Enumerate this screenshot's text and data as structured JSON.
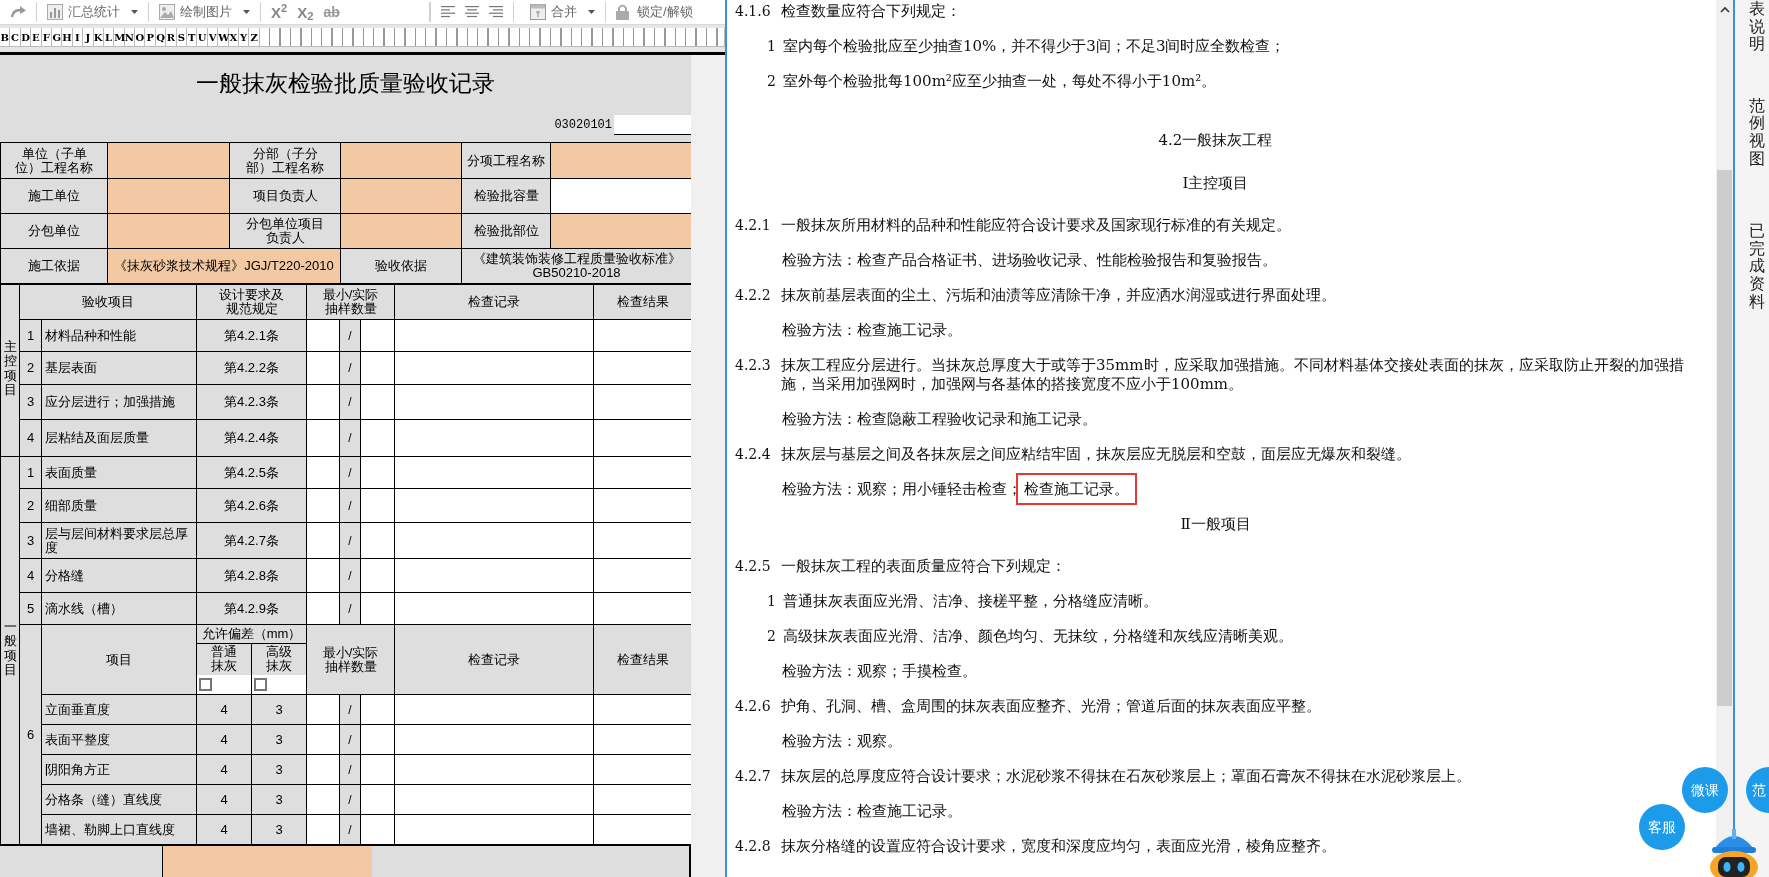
{
  "toolbar": {
    "groups": [
      [
        {
          "kind": "redo"
        }
      ],
      [
        {
          "kind": "chart_menu",
          "label": "汇总统计"
        }
      ],
      [
        {
          "kind": "picture_menu",
          "label": "绘制图片"
        }
      ],
      [
        {
          "kind": "superscript",
          "label": "X$^{2}$"
        },
        {
          "kind": "subscript",
          "label": "X$_{2}$"
        },
        {
          "kind": "strikethrough",
          "label": "ab"
        }
      ],
      [
        {
          "kind": "align_left"
        },
        {
          "kind": "align_center"
        },
        {
          "kind": "align_right"
        }
      ],
      [
        {
          "kind": "merge_menu",
          "label": "合并"
        }
      ],
      [
        {
          "kind": "lock",
          "label": "锁定/解锁"
        }
      ]
    ]
  },
  "column_letters": [
    "B",
    "C",
    "D",
    "E",
    "F",
    "G",
    "H",
    "I",
    "J",
    "K",
    "L",
    "M",
    "N",
    "O",
    "P",
    "Q",
    "R",
    "S",
    "T",
    "U",
    "V",
    "W",
    "X",
    "Y",
    "Z"
  ],
  "form": {
    "title": "一般抹灰检验批质量验收记录",
    "code": "03020101",
    "header_rows": [
      [
        {
          "kind": "label",
          "text": "单位（子单位）工程名称"
        },
        {
          "kind": "required"
        },
        {
          "kind": "label",
          "text": "分部（子分部）工程名称"
        },
        {
          "kind": "required"
        },
        {
          "kind": "label",
          "text": "分项工程名称"
        },
        {
          "kind": "required"
        }
      ],
      [
        {
          "kind": "label",
          "text": "施工单位"
        },
        {
          "kind": "required"
        },
        {
          "kind": "label",
          "text": "项目负责人"
        },
        {
          "kind": "required"
        },
        {
          "kind": "label",
          "text": "检验批容量"
        },
        {
          "kind": "blank"
        }
      ],
      [
        {
          "kind": "label",
          "text": "分包单位"
        },
        {
          "kind": "required"
        },
        {
          "kind": "label",
          "text": "分包单位项目负责人"
        },
        {
          "kind": "required"
        },
        {
          "kind": "label",
          "text": "检验批部位"
        },
        {
          "kind": "required"
        }
      ],
      [
        {
          "kind": "label",
          "text": "施工依据"
        },
        {
          "kind": "required",
          "text": "《抹灰砂浆技术规程》JGJ/T220-2010"
        },
        {
          "kind": "label",
          "text": "验收依据"
        },
        {
          "kind": "label",
          "text": "《建筑装饰装修工程质量验收标准》\nGB50210-2018"
        }
      ]
    ],
    "columns": [
      "验收项目",
      "设计要求及规范规定",
      "最小/实际抽样数量",
      "检查记录",
      "检查结果"
    ],
    "main_control": {
      "label": "主控项目",
      "rows": [
        {
          "no": "1",
          "item": "材料品种和性能",
          "clause": "第4.2.1条",
          "sample": "/"
        },
        {
          "no": "2",
          "item": "基层表面",
          "clause": "第4.2.2条",
          "sample": "/"
        },
        {
          "no": "3",
          "item": "应分层进行；加强措施",
          "clause": "第4.2.3条",
          "sample": "/"
        },
        {
          "no": "4",
          "item": "层粘结及面层质量",
          "clause": "第4.2.4条",
          "sample": "/"
        }
      ]
    },
    "general": {
      "label": "一般项目",
      "rows": [
        {
          "no": "1",
          "item": "表面质量",
          "clause": "第4.2.5条",
          "sample": "/"
        },
        {
          "no": "2",
          "item": "细部质量",
          "clause": "第4.2.6条",
          "sample": "/"
        },
        {
          "no": "3",
          "item": "层与层间材料要求层总厚度",
          "clause": "第4.2.7条",
          "sample": "/"
        },
        {
          "no": "4",
          "item": "分格缝",
          "clause": "第4.2.8条",
          "sample": "/"
        },
        {
          "no": "5",
          "item": "滴水线（槽）",
          "clause": "第4.2.9条",
          "sample": "/"
        }
      ],
      "tolerance": {
        "no": "6",
        "item_header": "项目",
        "group_header": "允许偏差（mm）",
        "grades": [
          {
            "label": "普通抹灰",
            "checked": false
          },
          {
            "label": "高级抹灰",
            "checked": false
          }
        ],
        "sample_header": "最小/实际抽样数量",
        "record_header": "检查记录",
        "result_header": "检查结果",
        "rows": [
          {
            "item": "立面垂直度",
            "ordinary": "4",
            "advanced": "3",
            "sample": "/"
          },
          {
            "item": "表面平整度",
            "ordinary": "4",
            "advanced": "3",
            "sample": "/"
          },
          {
            "item": "阴阳角方正",
            "ordinary": "4",
            "advanced": "3",
            "sample": "/"
          },
          {
            "item": "分格条（缝）直线度",
            "ordinary": "4",
            "advanced": "3",
            "sample": "/"
          },
          {
            "item": "墙裙、勒脚上口直线度",
            "ordinary": "4",
            "advanced": "3",
            "sample": "/"
          }
        ]
      }
    }
  },
  "document": {
    "paragraphs": [
      {
        "kind": "clause",
        "number": "4.1.6",
        "text": "检查数量应符合下列规定："
      },
      {
        "kind": "item",
        "number": "1",
        "text": "室内每个检验批应至少抽查10%，并不得少于3间；不足3间时应全数检查；"
      },
      {
        "kind": "item",
        "number": "2",
        "text": "室外每个检验批每100m²应至少抽查一处，每处不得小于10m²。"
      },
      {
        "kind": "title",
        "text": "4.2一般抹灰工程"
      },
      {
        "kind": "subtitle",
        "text": "Ⅰ主控项目"
      },
      {
        "kind": "clause",
        "number": "4.2.1",
        "text": "一般抹灰所用材料的品种和性能应符合设计要求及国家现行标准的有关规定。"
      },
      {
        "kind": "method",
        "text": "检验方法：检查产品合格证书、进场验收记录、性能检验报告和复验报告。"
      },
      {
        "kind": "clause",
        "number": "4.2.2",
        "text": "抹灰前基层表面的尘土、污垢和油渍等应清除干净，并应洒水润湿或进行界面处理。"
      },
      {
        "kind": "method",
        "text": "检验方法：检查施工记录。"
      },
      {
        "kind": "clause",
        "number": "4.2.3",
        "text": "抹灰工程应分层进行。当抹灰总厚度大于或等于35mm时，应采取加强措施。不同材料基体交接处表面的抹灰，应采取防止开裂的加强措施，当采用加强网时，加强网与各基体的搭接宽度不应小于100mm。"
      },
      {
        "kind": "method",
        "text": "检验方法：检查隐蔽工程验收记录和施工记录。"
      },
      {
        "kind": "clause",
        "number": "4.2.4",
        "text": "抹灰层与基层之间及各抹灰层之间应粘结牢固，抹灰层应无脱层和空鼓，面层应无爆灰和裂缝。"
      },
      {
        "kind": "method",
        "text": "检验方法：观察；用小锤轻击检查；",
        "highlight": "检查施工记录。"
      },
      {
        "kind": "subtitle",
        "text": "Ⅱ一般项目"
      },
      {
        "kind": "clause",
        "number": "4.2.5",
        "text": "一般抹灰工程的表面质量应符合下列规定："
      },
      {
        "kind": "item",
        "number": "1",
        "text": "普通抹灰表面应光滑、洁净、接槎平整，分格缝应清晰。"
      },
      {
        "kind": "item",
        "number": "2",
        "text": "高级抹灰表面应光滑、洁净、颜色均匀、无抹纹，分格缝和灰线应清晰美观。"
      },
      {
        "kind": "method",
        "text": "检验方法：观察；手摸检查。"
      },
      {
        "kind": "clause",
        "number": "4.2.6",
        "text": "护角、孔洞、槽、盒周围的抹灰表面应整齐、光滑；管道后面的抹灰表面应平整。"
      },
      {
        "kind": "method",
        "text": "检验方法：观察。"
      },
      {
        "kind": "clause",
        "number": "4.2.7",
        "text": "抹灰层的总厚度应符合设计要求；水泥砂浆不得抹在石灰砂浆层上；罩面石膏灰不得抹在水泥砂浆层上。"
      },
      {
        "kind": "method",
        "text": "检验方法：检查施工记录。"
      },
      {
        "kind": "clause",
        "number": "4.2.8",
        "text": "抹灰分格缝的设置应符合设计要求，宽度和深度应均匀，表面应光滑，棱角应整齐。"
      }
    ]
  },
  "side_panel": {
    "tabs": [
      "表说明",
      "范例视图",
      "已完成资料"
    ]
  },
  "floating_buttons": [
    {
      "label": "微课"
    },
    {
      "label": "范"
    },
    {
      "label": "客服"
    }
  ]
}
